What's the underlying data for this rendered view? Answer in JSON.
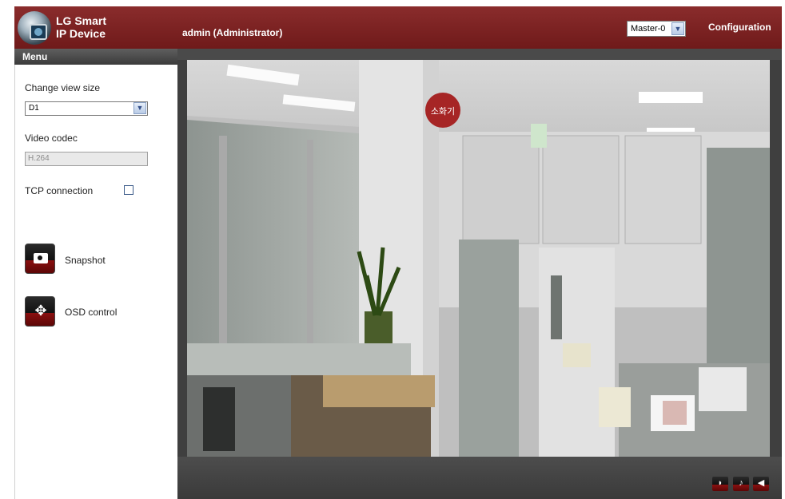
{
  "header": {
    "brand_line1": "LG Smart",
    "brand_line2": "IP Device",
    "user": "admin (Administrator)",
    "master_select": "Master-0",
    "configuration": "Configuration"
  },
  "sidebar": {
    "menu_title": "Menu",
    "view_size_label": "Change view size",
    "view_size_value": "D1",
    "codec_label": "Video codec",
    "codec_value": "H.264",
    "tcp_label": "TCP connection",
    "tcp_checked": false,
    "snapshot_label": "Snapshot",
    "osd_label": "OSD control"
  },
  "video": {
    "sign_text": "소화기"
  },
  "controls": {
    "buttons": [
      "talk",
      "microphone",
      "speaker"
    ]
  },
  "colors": {
    "header": "#7b2222",
    "accent_red": "#8a1010"
  }
}
